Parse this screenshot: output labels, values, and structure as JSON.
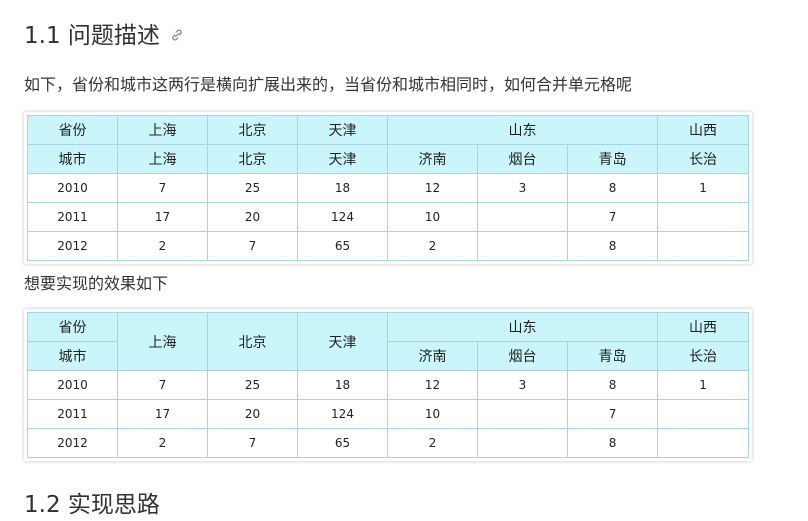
{
  "heading": {
    "text": "1.1 问题描述"
  },
  "intro": "如下，省份和城市这两行是横向扩展出来的，当省份和城市相同时，如何合并单元格呢",
  "caption2": "想要实现的效果如下",
  "next_heading": "1.2 实现思路",
  "table1": {
    "province_row": [
      "省份",
      "上海",
      "北京",
      "天津",
      "山东",
      "山西"
    ],
    "city_row": [
      "城市",
      "上海",
      "北京",
      "天津",
      "济南",
      "烟台",
      "青岛",
      "长治"
    ],
    "rows": [
      [
        "2010",
        "7",
        "25",
        "18",
        "12",
        "3",
        "8",
        "1"
      ],
      [
        "2011",
        "17",
        "20",
        "124",
        "10",
        "",
        "7",
        ""
      ],
      [
        "2012",
        "2",
        "7",
        "65",
        "2",
        "",
        "8",
        ""
      ]
    ]
  },
  "table2": {
    "province_row": [
      "省份",
      "上海",
      "北京",
      "天津",
      "山东",
      "山西"
    ],
    "city_row": [
      "城市",
      "济南",
      "烟台",
      "青岛",
      "长治"
    ],
    "rows": [
      [
        "2010",
        "7",
        "25",
        "18",
        "12",
        "3",
        "8",
        "1"
      ],
      [
        "2011",
        "17",
        "20",
        "124",
        "10",
        "",
        "7",
        ""
      ],
      [
        "2012",
        "2",
        "7",
        "65",
        "2",
        "",
        "8",
        ""
      ]
    ]
  },
  "colors": {
    "header_bg": "#caf5fb",
    "border": "#a7d2ea",
    "heading": "#303133"
  },
  "icons": {
    "anchor": "link-icon"
  }
}
